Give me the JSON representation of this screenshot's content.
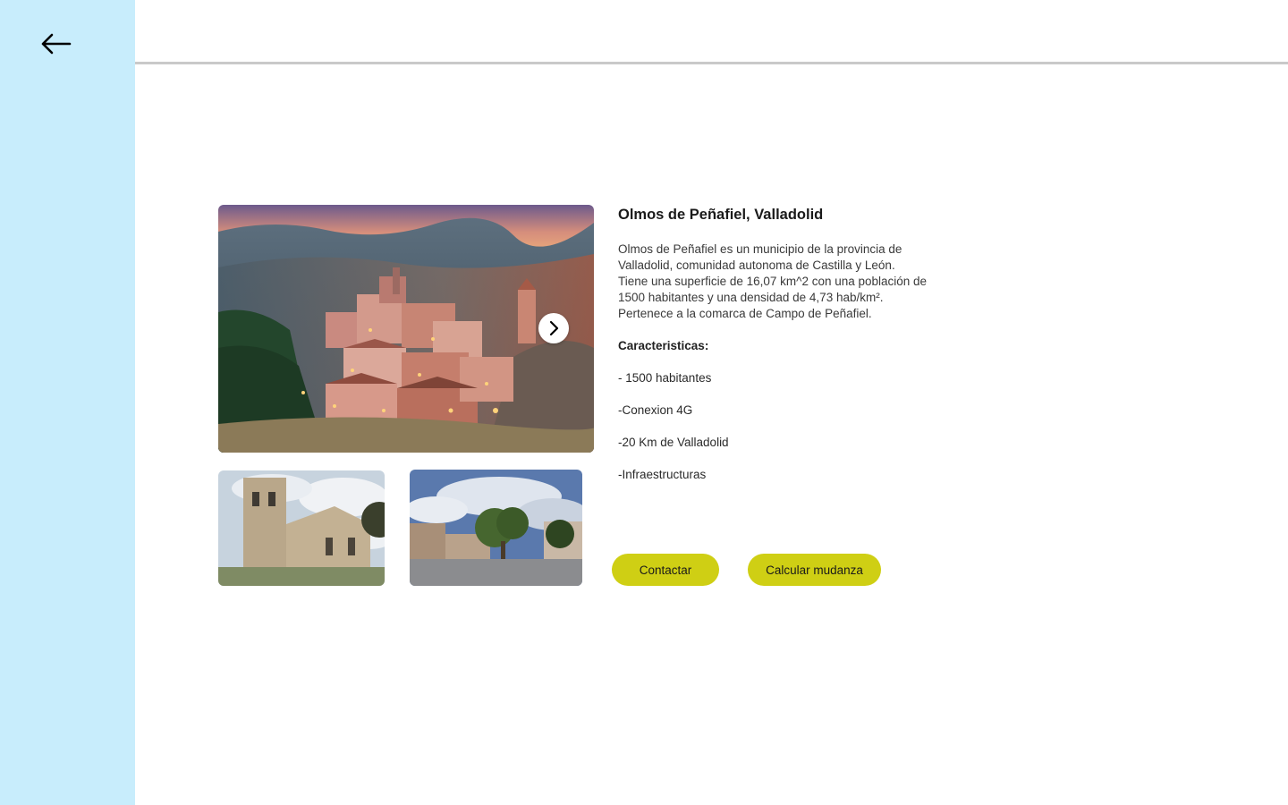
{
  "navigation": {
    "back_icon": "arrow-left-icon"
  },
  "gallery": {
    "next_icon": "chevron-right-icon",
    "images": [
      {
        "name": "main-photo"
      },
      {
        "name": "church-photo"
      },
      {
        "name": "plaza-photo"
      }
    ]
  },
  "place": {
    "title": "Olmos de Peñafiel, Valladolid",
    "description": [
      "Olmos de Peñafiel es un municipio de la provincia de",
      "Valladolid, comunidad autonoma de Castilla y León.",
      "Tiene una superficie de 16,07 km^2 con una población de",
      "1500 habitantes y una densidad de 4,73 hab/km².",
      "Pertenece a la comarca de Campo de Peñafiel."
    ],
    "features_heading": "Caracteristicas:",
    "features": [
      "- 1500 habitantes",
      "-Conexion 4G",
      "-20 Km de Valladolid",
      "-Infraestructuras"
    ]
  },
  "actions": {
    "contact_label": "Contactar",
    "calculate_label": "Calcular mudanza"
  },
  "colors": {
    "sidebar": "#c8edfc",
    "button": "#cfcf14",
    "divider": "#c9c9c9"
  }
}
